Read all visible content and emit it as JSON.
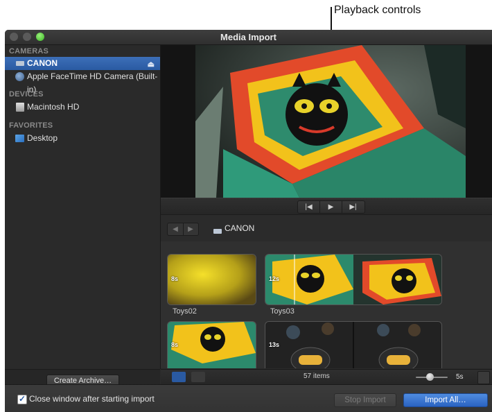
{
  "callout": {
    "label": "Playback controls"
  },
  "window": {
    "title": "Media Import"
  },
  "sidebar": {
    "sections": [
      {
        "header": "CAMERAS",
        "items": [
          "CANON",
          "Apple FaceTime HD Camera (Built-in)"
        ]
      },
      {
        "header": "DEVICES",
        "items": [
          "Macintosh HD"
        ]
      },
      {
        "header": "FAVORITES",
        "items": [
          "Desktop"
        ]
      }
    ],
    "selected": "CANON",
    "eject_glyph": "⏏",
    "create_archive": "Create Archive…"
  },
  "playback": {
    "prev": "|◀",
    "play": "▶",
    "next": "▶|"
  },
  "navigation": {
    "back": "◀",
    "forward": "▶",
    "location": "CANON"
  },
  "clips": [
    {
      "name": "Toys02",
      "duration": "8s"
    },
    {
      "name": "Toys03",
      "duration": "12s"
    },
    {
      "name": "",
      "duration": "8s"
    },
    {
      "name": "",
      "duration": "13s"
    }
  ],
  "status": {
    "item_count": "57 items",
    "duration_setting": "5s"
  },
  "footer": {
    "checkbox_label": "Close window after starting import",
    "checkbox_checked": true,
    "stop_import": "Stop Import",
    "import_all": "Import All…"
  },
  "colors": {
    "accent": "#2a5aa2",
    "window_bg": "#2b2b2b"
  }
}
